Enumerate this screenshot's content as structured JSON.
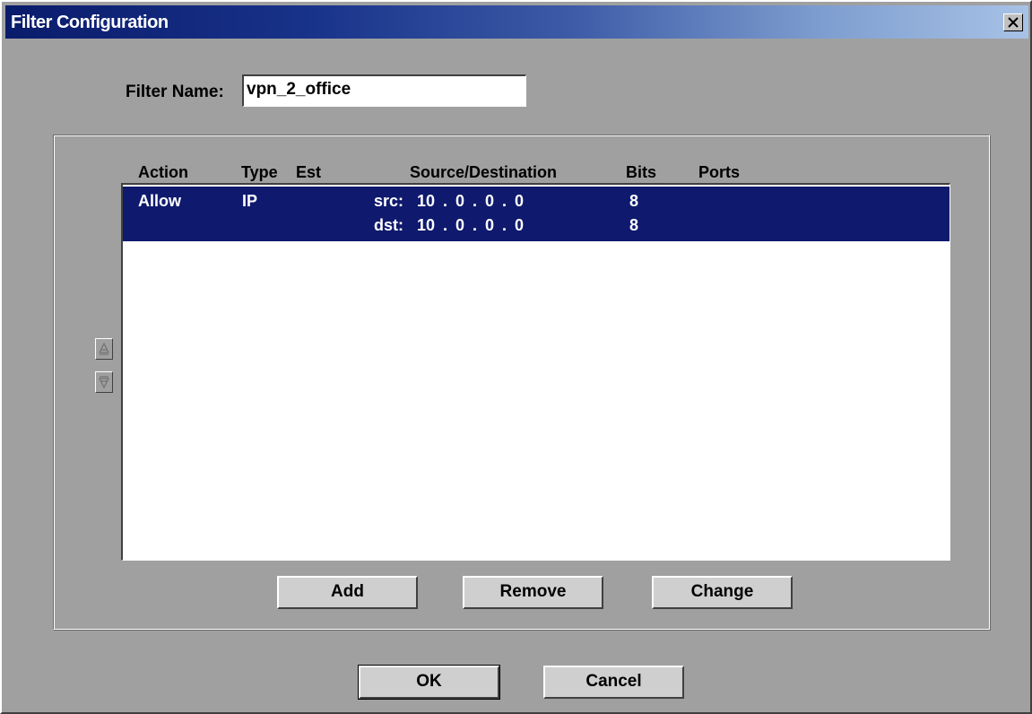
{
  "window": {
    "title": "Filter Configuration",
    "close_glyph": "✕"
  },
  "filter_name": {
    "label": "Filter Name:",
    "value": "vpn_2_office"
  },
  "table": {
    "headers": {
      "action": "Action",
      "type": "Type",
      "est": "Est",
      "source_destination": "Source/Destination",
      "bits": "Bits",
      "ports": "Ports"
    },
    "rows": [
      {
        "action": "Allow",
        "type": "IP",
        "est": "",
        "src_label": "src:",
        "src_address": "10 . 0 . 0 . 0",
        "src_bits": "8",
        "dst_label": "dst:",
        "dst_address": "10 . 0 . 0 . 0",
        "dst_bits": "8",
        "ports": "",
        "selected": true
      }
    ]
  },
  "reorder": {
    "up_icon": "move-up-icon",
    "down_icon": "move-down-icon"
  },
  "list_buttons": {
    "add": "Add",
    "remove": "Remove",
    "change": "Change"
  },
  "dialog_buttons": {
    "ok": "OK",
    "cancel": "Cancel"
  },
  "colors": {
    "dialog_background": "#a0a0a0",
    "selection": "#0f1a6e",
    "title_bar_start": "#0a1b6b",
    "title_bar_end": "#a8c2e6"
  }
}
